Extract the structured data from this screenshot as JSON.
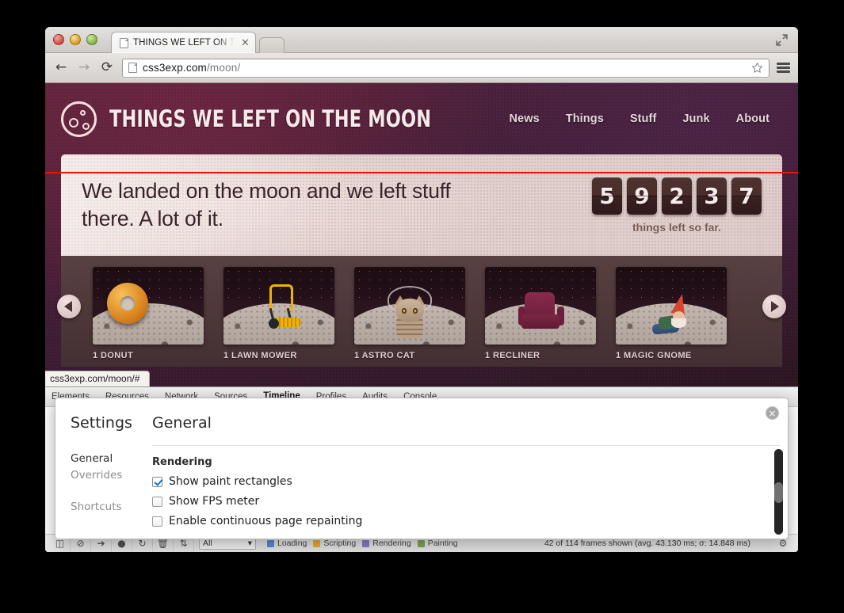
{
  "browser": {
    "tab": {
      "title": "THINGS WE LEFT ON THE M",
      "close_label": "×"
    },
    "back_label": "←",
    "forward_label": "→",
    "reload_label": "⟳",
    "url_host": "css3exp.com",
    "url_path": "/moon/",
    "url_full": "css3exp.com/moon/",
    "status_url": "css3exp.com/moon/#"
  },
  "site": {
    "title": "THINGS WE LEFT ON THE MOON",
    "nav": [
      {
        "label": "News"
      },
      {
        "label": "Things"
      },
      {
        "label": "Stuff"
      },
      {
        "label": "Junk"
      },
      {
        "label": "About"
      }
    ],
    "hero": {
      "headline": "We landed on the moon and we left stuff there. A lot of it.",
      "counter_digits": [
        "5",
        "9",
        "2",
        "3",
        "7"
      ],
      "counter_value": "59237",
      "counter_label": "things left so far."
    },
    "carousel": {
      "prev_label": "◀",
      "next_label": "▶",
      "cards": [
        {
          "label": "1 DONUT",
          "object": "donut"
        },
        {
          "label": "1 LAWN MOWER",
          "object": "mower"
        },
        {
          "label": "1 ASTRO CAT",
          "object": "cat"
        },
        {
          "label": "1 RECLINER",
          "object": "chair"
        },
        {
          "label": "1 MAGIC GNOME",
          "object": "gnome"
        }
      ]
    }
  },
  "devtools": {
    "tabs": [
      {
        "label": "Elements"
      },
      {
        "label": "Resources"
      },
      {
        "label": "Network"
      },
      {
        "label": "Sources"
      },
      {
        "label": "Timeline",
        "active": true
      },
      {
        "label": "Profiles"
      },
      {
        "label": "Audits"
      },
      {
        "label": "Console"
      }
    ],
    "statusbar": {
      "filter_value": "All",
      "legend": [
        {
          "label": "Loading",
          "color": "#5d8fd6"
        },
        {
          "label": "Scripting",
          "color": "#f0b040"
        },
        {
          "label": "Rendering",
          "color": "#8f7fd0"
        },
        {
          "label": "Painting",
          "color": "#7fa85f"
        }
      ],
      "frames_text": "42 of 114 frames shown (avg. 43.130 ms; σ: 14.848 ms)"
    }
  },
  "settings": {
    "title": "Settings",
    "pane_title": "General",
    "close_label": "×",
    "nav": [
      {
        "label": "General",
        "active": true
      },
      {
        "label": "Overrides",
        "active": false
      },
      {
        "label": "Shortcuts",
        "active": false
      }
    ],
    "section_title": "Rendering",
    "options": [
      {
        "label": "Show paint rectangles",
        "checked": true
      },
      {
        "label": "Show FPS meter",
        "checked": false
      },
      {
        "label": "Enable continuous page repainting",
        "checked": false
      }
    ]
  },
  "colors": {
    "paint_rect": "#ef1111",
    "accent_blue": "#1473c9",
    "site_bg": "#3d1c33"
  }
}
